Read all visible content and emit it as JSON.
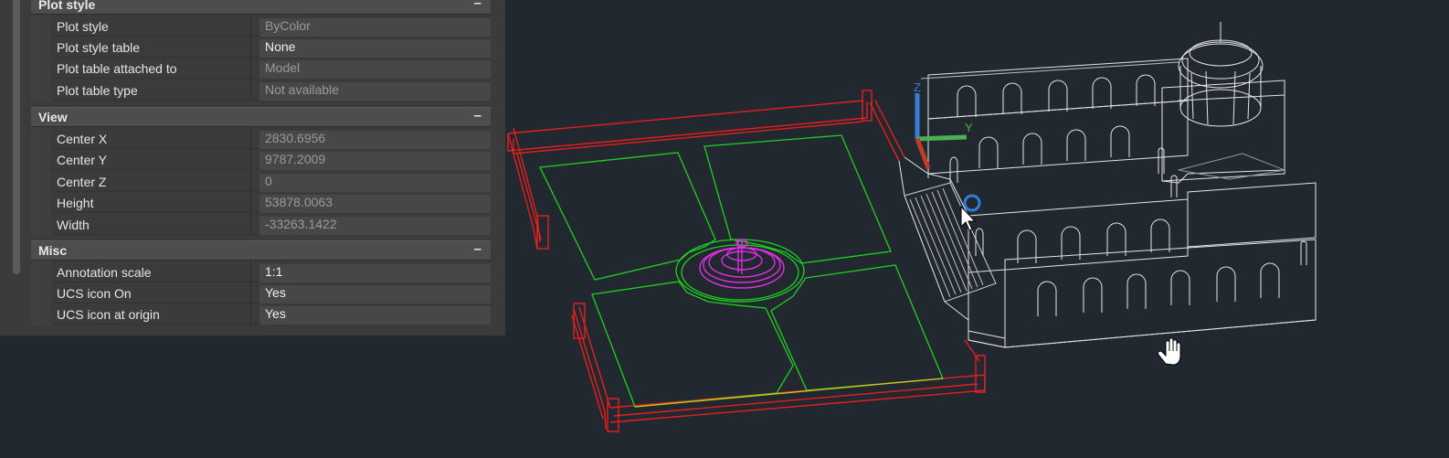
{
  "sections": [
    {
      "title": "Plot style",
      "collapse": "–",
      "rows": [
        {
          "label": "Plot style",
          "value": "ByColor",
          "dim": true
        },
        {
          "label": "Plot style table",
          "value": "None",
          "dim": false
        },
        {
          "label": "Plot table attached to",
          "value": "Model",
          "dim": true
        },
        {
          "label": "Plot table type",
          "value": "Not available",
          "dim": true
        }
      ]
    },
    {
      "title": "View",
      "collapse": "–",
      "rows": [
        {
          "label": "Center X",
          "value": "2830.6956",
          "dim": true
        },
        {
          "label": "Center Y",
          "value": "9787.2009",
          "dim": true
        },
        {
          "label": "Center Z",
          "value": "0",
          "dim": true
        },
        {
          "label": "Height",
          "value": "53878.0063",
          "dim": true
        },
        {
          "label": "Width",
          "value": "-33263.1422",
          "dim": true
        }
      ]
    },
    {
      "title": "Misc",
      "collapse": "–",
      "rows": [
        {
          "label": "Annotation scale",
          "value": "1:1",
          "dim": false
        },
        {
          "label": "UCS icon On",
          "value": "Yes",
          "dim": false
        },
        {
          "label": "UCS icon at origin",
          "value": "Yes",
          "dim": false
        }
      ]
    }
  ],
  "ucs": {
    "z": "Z",
    "y": "Y"
  },
  "colors": {
    "background": "#212830",
    "wall": "#e81e1e",
    "garden": "#1ed21e",
    "fountain": "#e02ee0",
    "building": "#e6e6e6",
    "ucs_x": "#c0392b",
    "ucs_y": "#4caf50",
    "ucs_z": "#3a7bd5"
  },
  "icons": [
    "arrow-cursor-icon",
    "hand-pan-icon",
    "ucs-origin-icon"
  ]
}
